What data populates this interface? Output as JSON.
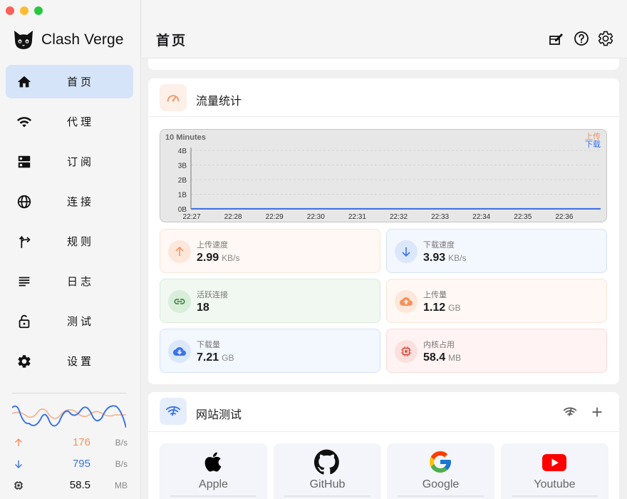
{
  "app": {
    "name": "Clash Verge"
  },
  "sidebar": {
    "items": [
      {
        "label": "首页",
        "icon": "home-icon",
        "active": true
      },
      {
        "label": "代理",
        "icon": "wifi-icon",
        "active": false
      },
      {
        "label": "订阅",
        "icon": "dns-icon",
        "active": false
      },
      {
        "label": "连接",
        "icon": "globe-icon",
        "active": false
      },
      {
        "label": "规则",
        "icon": "fork-icon",
        "active": false
      },
      {
        "label": "日志",
        "icon": "subject-icon",
        "active": false
      },
      {
        "label": "测试",
        "icon": "lock-open-icon",
        "active": false
      },
      {
        "label": "设置",
        "icon": "gear-icon",
        "active": false
      }
    ],
    "traffic": {
      "upload": {
        "value": "176",
        "unit": "B/s"
      },
      "download": {
        "value": "795",
        "unit": "B/s"
      },
      "memory": {
        "value": "58.5",
        "unit": "MB"
      }
    }
  },
  "header": {
    "title": "首页"
  },
  "traffic_card": {
    "title": "流量统计",
    "chart_tag": "10 Minutes",
    "legend_upload": "上传",
    "legend_download": "下载",
    "y_ticks": [
      "4B",
      "3B",
      "2B",
      "1B",
      "0B"
    ],
    "x_ticks": [
      "22:27",
      "22:28",
      "22:29",
      "22:30",
      "22:31",
      "22:32",
      "22:33",
      "22:34",
      "22:35",
      "22:36"
    ],
    "stats": [
      {
        "label": "上传速度",
        "value": "2.99",
        "unit": "KB/s",
        "icon": "arrow-up-icon"
      },
      {
        "label": "下载速度",
        "value": "3.93",
        "unit": "KB/s",
        "icon": "arrow-down-icon"
      },
      {
        "label": "活跃连接",
        "value": "18",
        "unit": "",
        "icon": "link-icon"
      },
      {
        "label": "上传量",
        "value": "1.12",
        "unit": "GB",
        "icon": "cloud-upload-icon"
      },
      {
        "label": "下载量",
        "value": "7.21",
        "unit": "GB",
        "icon": "cloud-download-icon"
      },
      {
        "label": "内核占用",
        "value": "58.4",
        "unit": "MB",
        "icon": "memory-icon"
      }
    ]
  },
  "site_card": {
    "title": "网站测试",
    "sites": [
      "Apple",
      "GitHub",
      "Google",
      "Youtube"
    ]
  },
  "colors": {
    "upload": "#f29361",
    "download": "#3a73e8",
    "active_nav": "#d6e4f9"
  }
}
